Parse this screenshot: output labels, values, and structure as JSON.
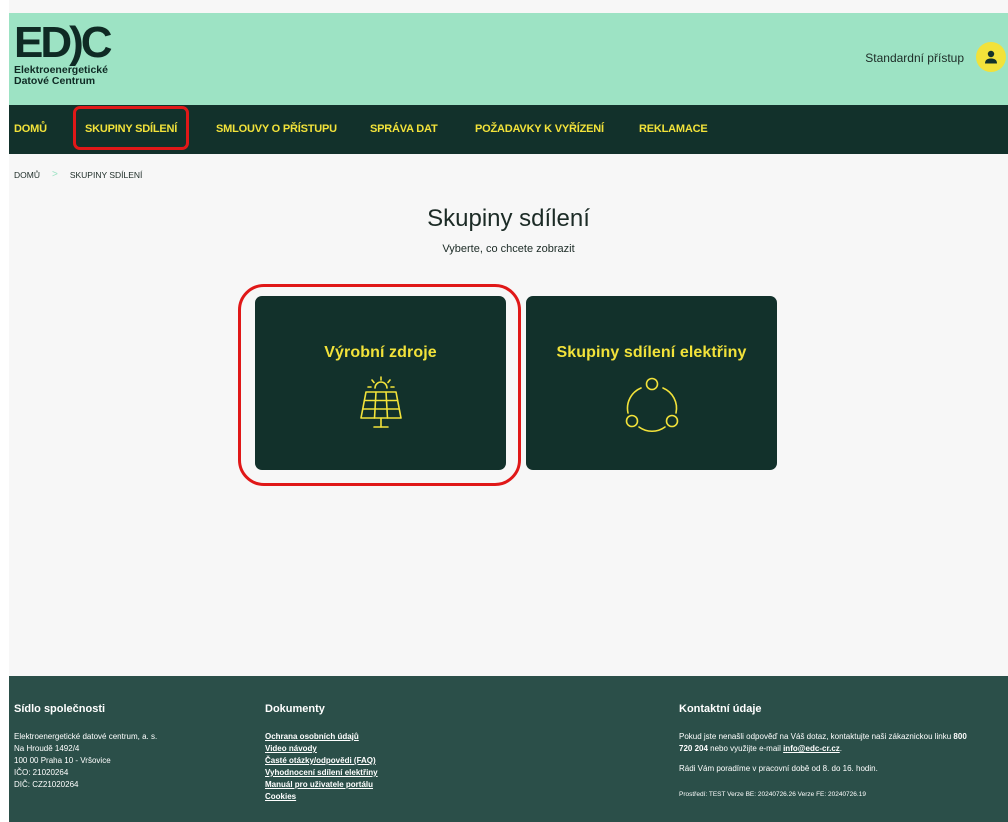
{
  "header": {
    "logo_mark": "ED)C",
    "logo_line1": "Elektroenergetické",
    "logo_line2": "Datové Centrum",
    "access_label": "Standardní přístup",
    "user_icon": "user-icon"
  },
  "nav": {
    "items": [
      {
        "label": "DOMŮ"
      },
      {
        "label": "SKUPINY SDÍLENÍ"
      },
      {
        "label": "SMLOUVY O PŘÍSTUPU"
      },
      {
        "label": "SPRÁVA DAT"
      },
      {
        "label": "POŽADAVKY K VYŘÍZENÍ"
      },
      {
        "label": "REKLAMACE"
      }
    ],
    "active": "SKUPINY SDÍLENÍ"
  },
  "breadcrumb": {
    "home": "DOMŮ",
    "separator": ">",
    "current": "SKUPINY SDÍLENÍ"
  },
  "main": {
    "title": "Skupiny sdílení",
    "subtitle": "Vyberte, co chcete zobrazit",
    "cards": [
      {
        "title": "Výrobní zdroje",
        "icon": "solar-panel-icon"
      },
      {
        "title": "Skupiny sdílení elektřiny",
        "icon": "sharing-circle-icon"
      }
    ]
  },
  "footer": {
    "company": {
      "heading": "Sídlo společnosti",
      "lines": [
        "Elektroenergetické datové centrum, a. s.",
        "Na Hroudě 1492/4",
        "100 00 Praha 10 - Vršovice",
        "IČO: 21020264",
        "DIČ: CZ21020264"
      ]
    },
    "documents": {
      "heading": "Dokumenty",
      "links": [
        "Ochrana osobních údajů",
        "Video návody",
        "Časté otázky/odpovědi (FAQ)",
        "Vyhodnocení sdílení elektřiny",
        "Manuál pro uživatele portálu",
        "Cookies"
      ]
    },
    "contact": {
      "heading": "Kontaktní údaje",
      "text_before_phone": "Pokud jste nenašli odpověď na Váš dotaz, kontaktujte naši zákaznickou linku ",
      "phone": "800 720 204",
      "text_before_email": " nebo využijte e-mail ",
      "email": "info@edc-cr.cz",
      "text_after_email": ".",
      "hours": "Rádi Vám poradíme v pracovní době od 8. do 16. hodin.",
      "environment": "Prostředí: TEST    Verze BE: 20240726.26    Verze FE: 20240726.19"
    }
  },
  "colors": {
    "header_bg": "#9de3c4",
    "nav_bg": "#12312b",
    "accent_yellow": "#f2e23a",
    "card_bg": "#12312b",
    "footer_bg": "#2b4f49",
    "highlight_red": "#e01818"
  }
}
